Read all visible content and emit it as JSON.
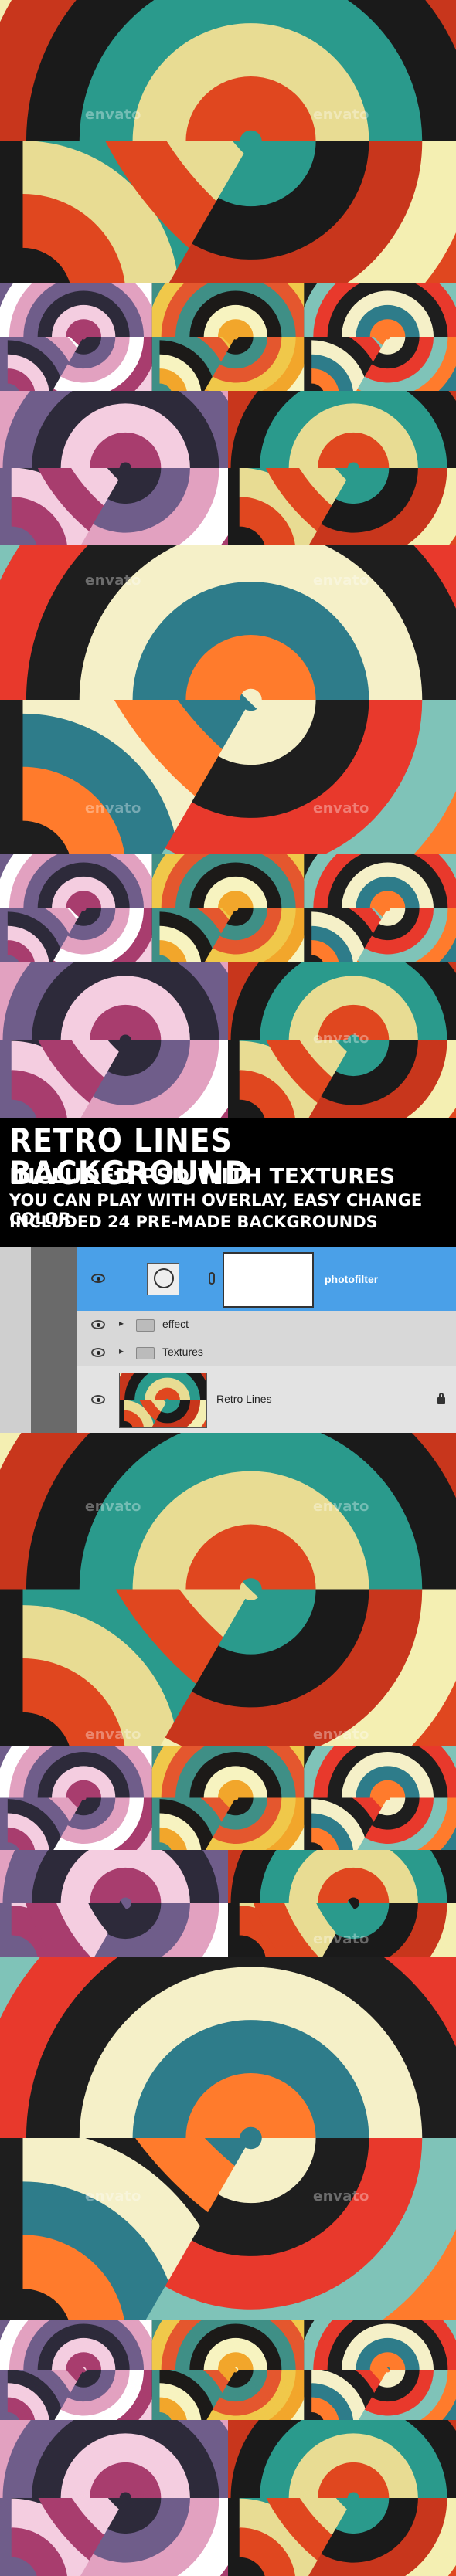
{
  "watermark": "envato",
  "title": {
    "line1": "RETRO LINES BACKGROUND",
    "line2": "INCLUDED PSD WITH TEXTURES",
    "line3": "YOU CAN PLAY WITH OVERLAY, EASY CHANGE COLOR",
    "line4": "INCLUDED 24 PRE-MADE BACKGROUNDS"
  },
  "layers_panel": {
    "layers": [
      {
        "name": "photofilter",
        "type": "adjustment",
        "active": true
      },
      {
        "name": "effect",
        "type": "folder"
      },
      {
        "name": "Textures",
        "type": "folder"
      },
      {
        "name": "Retro Lines",
        "type": "image",
        "locked": true
      }
    ]
  },
  "palettes": {
    "a": [
      "#e0471f",
      "#e8dc93",
      "#2a9a8c",
      "#1a1a1a",
      "#c8361c",
      "#f4efb2"
    ],
    "b": [
      "#f2a62b",
      "#f7f3c0",
      "#1c1a18",
      "#3f8f86",
      "#e4572e",
      "#f0c84a"
    ],
    "c": [
      "#a83d6e",
      "#f4cde0",
      "#2d2a3a",
      "#6f5d8a",
      "#e2a1c0",
      "#ffffff"
    ],
    "d": [
      "#ff7b2c",
      "#2e7c8a",
      "#f5f0c8",
      "#1e1e1e",
      "#e8392c",
      "#7fc3b8"
    ]
  }
}
